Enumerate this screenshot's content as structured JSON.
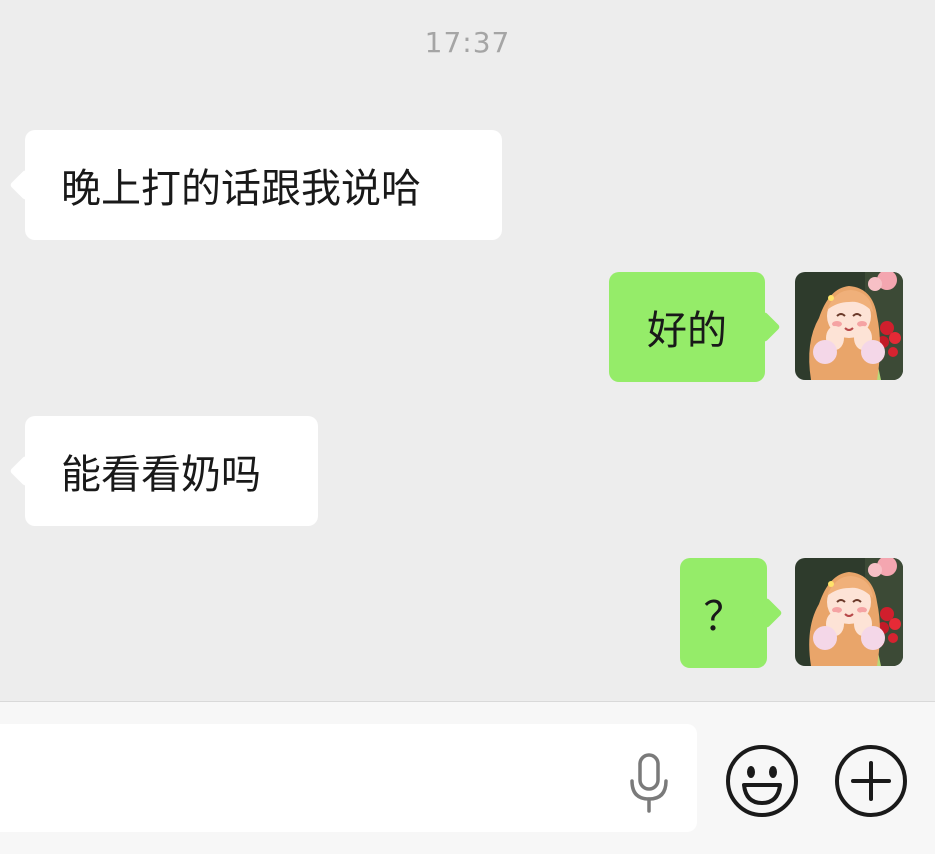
{
  "chat": {
    "timestamp": "17:37",
    "messages": [
      {
        "direction": "incoming",
        "text": "晚上打的话跟我说哈"
      },
      {
        "direction": "outgoing",
        "text": "好的"
      },
      {
        "direction": "incoming",
        "text": "能看看奶吗"
      },
      {
        "direction": "outgoing",
        "text": "？"
      }
    ]
  },
  "input_bar": {
    "text_value": "",
    "voice_icon": "microphone-icon",
    "emoji_icon": "smiley-face-icon",
    "more_icon": "plus-circle-icon"
  },
  "colors": {
    "background": "#ededed",
    "incoming_bubble": "#ffffff",
    "outgoing_bubble": "#95ec69",
    "timestamp_text": "#a5a5a5",
    "message_text": "#191919"
  }
}
